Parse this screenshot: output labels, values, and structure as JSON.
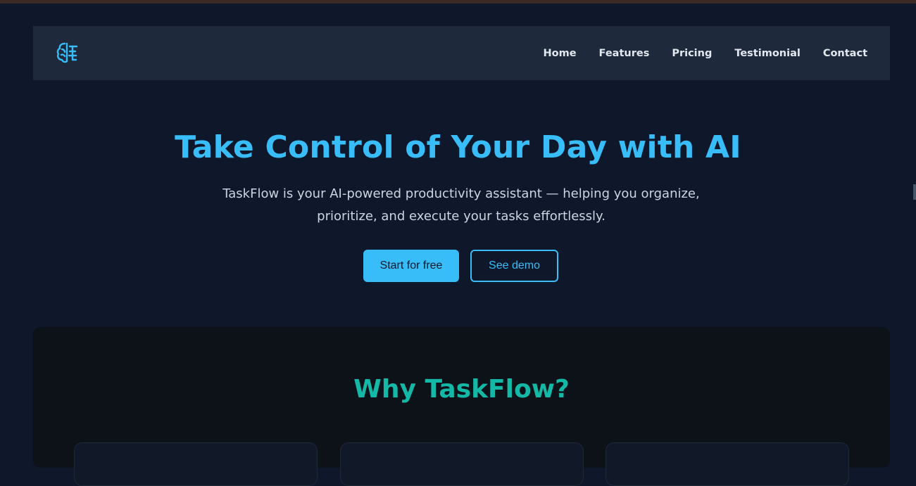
{
  "nav": {
    "logo_icon": "brain-icon",
    "links": [
      "Home",
      "Features",
      "Pricing",
      "Testimonial",
      "Contact"
    ]
  },
  "hero": {
    "title": "Take Control of Your Day with AI",
    "subtitle": "TaskFlow is your AI-powered productivity assistant — helping you organize, prioritize, and execute your tasks effortlessly.",
    "primary_button": "Start for free",
    "secondary_button": "See demo"
  },
  "why": {
    "title": "Why TaskFlow?"
  },
  "colors": {
    "accent": "#38bdf8",
    "teal": "#14b8a6",
    "background": "#0f172a",
    "navbar": "#1e293b"
  }
}
